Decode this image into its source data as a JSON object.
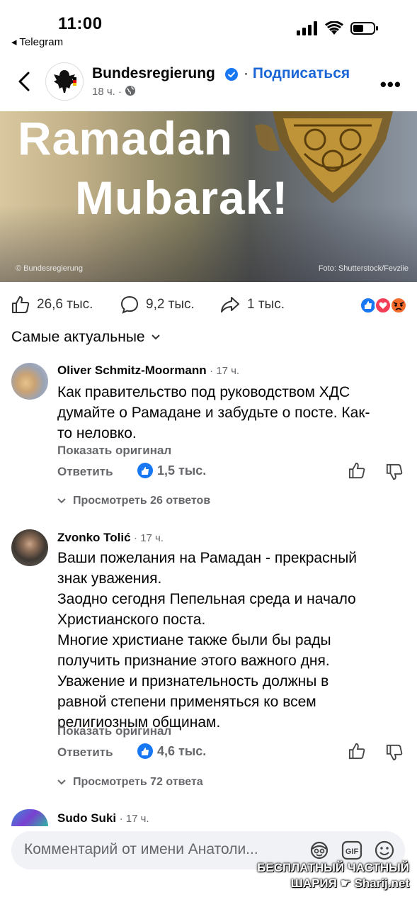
{
  "status_bar": {
    "time": "11:00",
    "back_app": "◂ Telegram"
  },
  "header": {
    "page_name": "Bundesregierung",
    "subscribe_prefix": "·",
    "subscribe_label": "Подписаться",
    "post_time": "18 ч. ·",
    "visibility_icon": "globe-icon"
  },
  "banner": {
    "line1": "Ramadan",
    "line2": "Mubarak!",
    "credit_left": "© Bundesregierung",
    "credit_right": "Foto: Shutterstock/Fevziie"
  },
  "stats": {
    "likes": "26,6 тыс.",
    "comments": "9,2 тыс.",
    "shares": "1 тыс."
  },
  "sort": {
    "label": "Самые актуальные"
  },
  "comments": [
    {
      "author": "Oliver Schmitz-Moormann",
      "time": "· 17 ч.",
      "lines": [
        "Как правительство под руководством ХДС",
        "думайте о Рамадане и забудьте о посте. Как-",
        "то неловко."
      ],
      "show_original": "Показать оригинал",
      "reply": "Ответить",
      "likes": "1,5 тыс.",
      "view_replies": "Просмотреть 26 ответов"
    },
    {
      "author": "Zvonko Tolić",
      "time": "· 17 ч.",
      "lines": [
        "Ваши пожелания на Рамадан - прекрасный",
        "знак уважения.",
        "Заодно сегодня Пепельная среда и начало",
        "Христианского поста.",
        "Многие христиане также были бы рады",
        "получить признание этого важного дня.",
        "Уважение и признательность должны в",
        "равной степени применяться ко всем",
        "религиозным общинам."
      ],
      "show_original": "Показать оригинал",
      "reply": "Ответить",
      "likes": "4,6 тыс.",
      "view_replies": "Просмотреть 72 ответа"
    },
    {
      "author": "Sudo Suki",
      "time": "· 17 ч."
    }
  ],
  "composer": {
    "placeholder": "Комментарий от имени Анатоли..."
  },
  "watermark": {
    "line1": "БЕСПЛАТНЫЙ ЧАСТНЫЙ",
    "line2": "ШАРИЯ ☛ Sharij.net"
  },
  "colors": {
    "accent": "#1a66d6",
    "like_blue": "#1877f2",
    "muted": "#65676b"
  }
}
